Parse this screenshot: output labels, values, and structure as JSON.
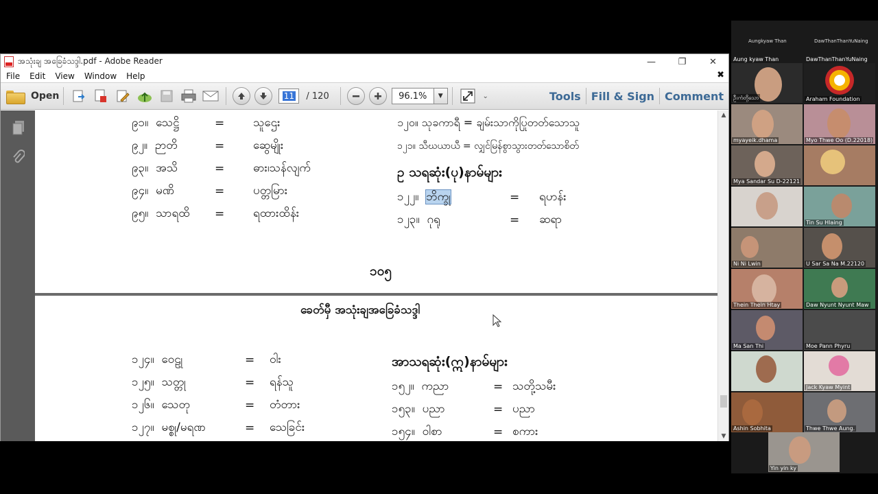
{
  "window": {
    "title": "အသုံးချ အခြေခံသဒ္ဒါ.pdf - Adobe Reader",
    "controls": {
      "minimize": "—",
      "maximize": "❐",
      "close": "✕"
    }
  },
  "menu": {
    "items": [
      "File",
      "Edit",
      "View",
      "Window",
      "Help"
    ],
    "close": "✖"
  },
  "toolbar": {
    "open_label": "Open",
    "current_page": "11",
    "page_total": "/ 120",
    "zoom": "96.1%",
    "tools": "Tools",
    "fill_sign": "Fill & Sign",
    "comment": "Comment"
  },
  "document": {
    "page1_left": [
      {
        "num": "၉၁။",
        "word": "သေဋ္ဌိ",
        "eq": "=",
        "meaning": "သူဌေး"
      },
      {
        "num": "၉၂။",
        "word": "ဉာတိ",
        "eq": "=",
        "meaning": "ဆွေမျိုး"
      },
      {
        "num": "၉၃။",
        "word": "အသိ",
        "eq": "=",
        "meaning": "ဓား၊သန်လျက်"
      },
      {
        "num": "၉၄။",
        "word": "မဏိ",
        "eq": "=",
        "meaning": "ပတ္တမြား"
      },
      {
        "num": "၉၅။",
        "word": "သာရထိ",
        "eq": "=",
        "meaning": "ရထားထိန်း"
      }
    ],
    "page1_right_lines": [
      "၁၂၀။ သုခကာရီ = ချမ်းသာကိုပြုတတ်သောသူ",
      "၁၂၁။ သီဃယာယီ = လျှင်မြန်စွာသွားတတ်သောစိတ်"
    ],
    "page1_right_heading": "ဥ သရဆုံး(ပု)နာမ်များ",
    "page1_right_rows": [
      {
        "num": "၁၂၂။",
        "word": "ဘိက္ခု",
        "eq": "=",
        "meaning": "ရဟန်း"
      },
      {
        "num": "၁၂၃။",
        "word": "ဂုရု",
        "eq": "=",
        "meaning": "ဆရာ"
      }
    ],
    "page_number": "၁၀၅",
    "page2_title": "ခေတ်မှီ အသုံးချအခြေခံသဒ္ဒါ",
    "page2_left": [
      {
        "num": "၁၂၄။",
        "word": "ဝေဠု",
        "eq": "=",
        "meaning": "ဝါး"
      },
      {
        "num": "၁၂၅။",
        "word": "သတ္တု",
        "eq": "=",
        "meaning": "ရန်သူ"
      },
      {
        "num": "၁၂၆။",
        "word": "သေတု",
        "eq": "=",
        "meaning": "တံတား"
      },
      {
        "num": "၁၂၇။",
        "word": "မစ္စု/မရဏ",
        "eq": "=",
        "meaning": "သေခြင်း"
      }
    ],
    "page2_right_heading": "အာသရဆုံး(ဣ)နာမ်များ",
    "page2_right_rows": [
      {
        "num": "၁၅၂။",
        "word": "ကညာ",
        "eq": "=",
        "meaning": "သတို့သမီး"
      },
      {
        "num": "၁၅၃။",
        "word": "ပညာ",
        "eq": "=",
        "meaning": "ပညာ"
      },
      {
        "num": "၁၅၄။",
        "word": "ဝါစာ",
        "eq": "=",
        "meaning": "စကား"
      }
    ]
  },
  "participants": {
    "top_labels": [
      "Aungkyaw Than",
      "DawThanThanYuNaing"
    ],
    "tiles": [
      "Aung kyaw Than",
      "DawThanThanYuNaing",
      "ဦးကံတို့သော",
      "Araham Foundation",
      "myayeik.dhama",
      "Myo Thwe Oo (D.22018)",
      "Mya Sandar Su D-22121",
      "",
      "",
      "Tin Su Hlaing",
      "Ni Ni Lwin",
      "U Sar Sa Na M.22120",
      "Thein Thein Htay",
      "Daw Nyunt Nyunt Maw",
      "Ma San Thi",
      "Moe Pann Phyru",
      "",
      "Jack Kyaw Myint",
      "Ashin Sobhita",
      "Thwe Thwe Aung.",
      "Yin yin ky"
    ]
  },
  "colors": {
    "toolbar_link": "#3d6a96",
    "highlight": "#b9d4ef",
    "panel": "#5a5a5a"
  }
}
